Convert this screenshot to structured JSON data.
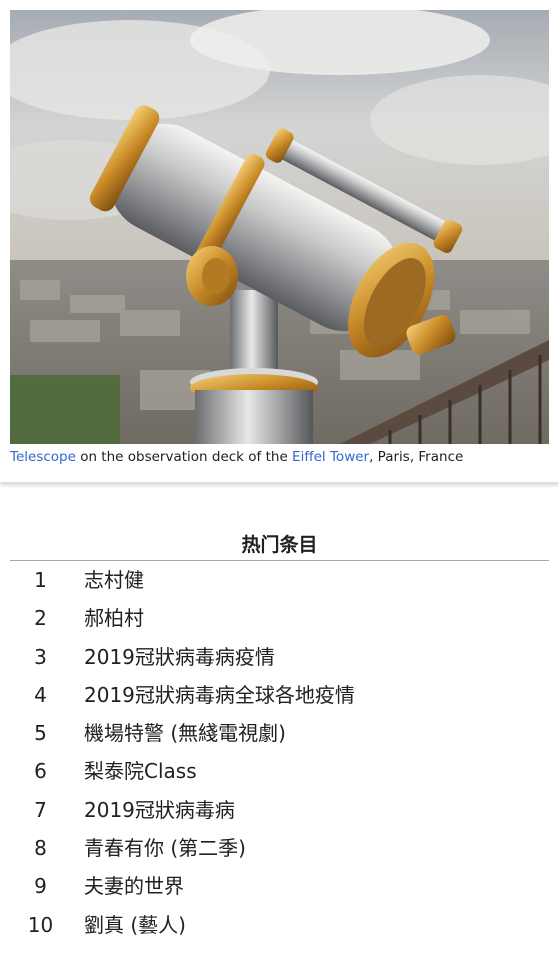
{
  "featured_picture": {
    "caption": {
      "link1": "Telescope",
      "text1": " on the observation deck of the ",
      "link2": "Eiffel Tower",
      "text2": ", Paris, France"
    },
    "link_color": "#3366cc"
  },
  "top_articles": {
    "title": "热门条目",
    "items": [
      {
        "rank": "1",
        "name": "志村健"
      },
      {
        "rank": "2",
        "name": "郝柏村"
      },
      {
        "rank": "3",
        "name": "2019冠狀病毒病疫情"
      },
      {
        "rank": "4",
        "name": "2019冠狀病毒病全球各地疫情"
      },
      {
        "rank": "5",
        "name": "機場特警 (無綫電視劇)"
      },
      {
        "rank": "6",
        "name": "梨泰院Class"
      },
      {
        "rank": "7",
        "name": "2019冠狀病毒病"
      },
      {
        "rank": "8",
        "name": "青春有你 (第二季)"
      },
      {
        "rank": "9",
        "name": "夫妻的世界"
      },
      {
        "rank": "10",
        "name": "劉真 (藝人)"
      }
    ]
  }
}
